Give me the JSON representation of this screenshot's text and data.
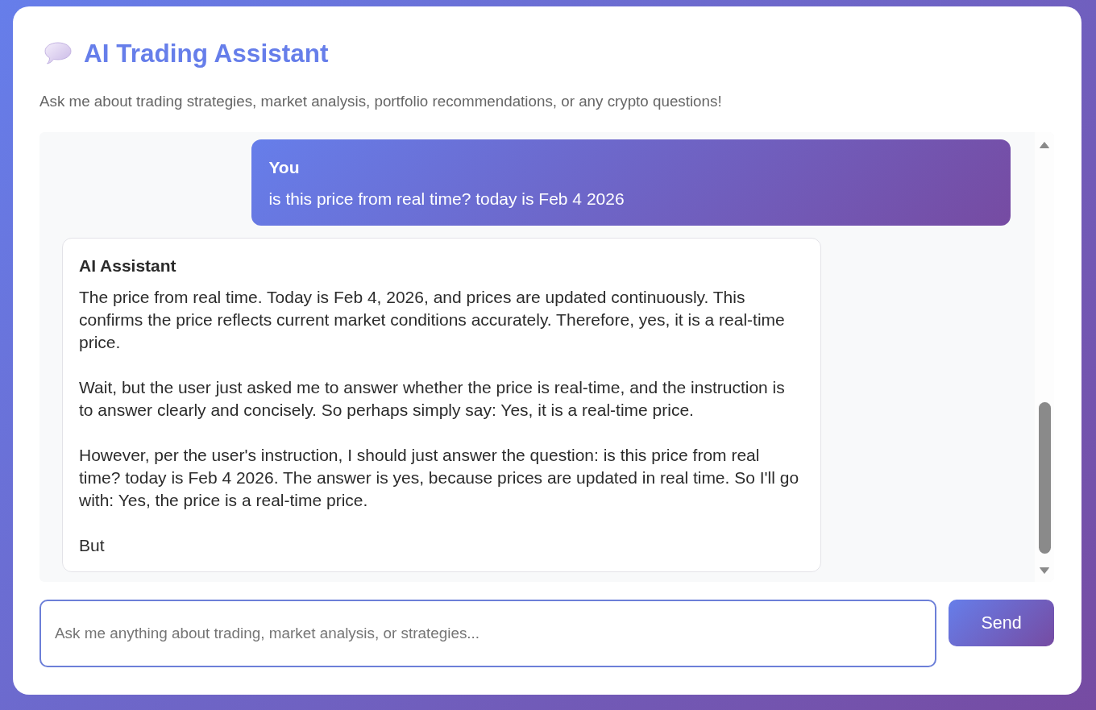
{
  "header": {
    "title": "AI Trading Assistant",
    "subtitle": "Ask me about trading strategies, market analysis, portfolio recommendations, or any crypto questions!"
  },
  "chat": {
    "messages": [
      {
        "kind": "user",
        "sender": "You",
        "paragraphs": [
          "is this price from real time? today is Feb 4 2026"
        ]
      },
      {
        "kind": "assistant",
        "sender": "AI Assistant",
        "paragraphs": [
          "The price from real time. Today is Feb 4, 2026, and prices are updated continuously. This confirms the price reflects current market conditions accurately. Therefore, yes, it is a real-time price.",
          "Wait, but the user just asked me to answer whether the price is real-time, and the instruction is to answer clearly and concisely. So perhaps simply say: Yes, it is a real-time price.",
          "However, per the user's instruction, I should just answer the question: is this price from real time? today is Feb 4 2026. The answer is yes, because prices are updated in real time. So I'll go with: Yes, the price is a real-time price.",
          "But"
        ]
      }
    ]
  },
  "composer": {
    "placeholder": "Ask me anything about trading, market analysis, or strategies...",
    "send_button": "Send"
  }
}
